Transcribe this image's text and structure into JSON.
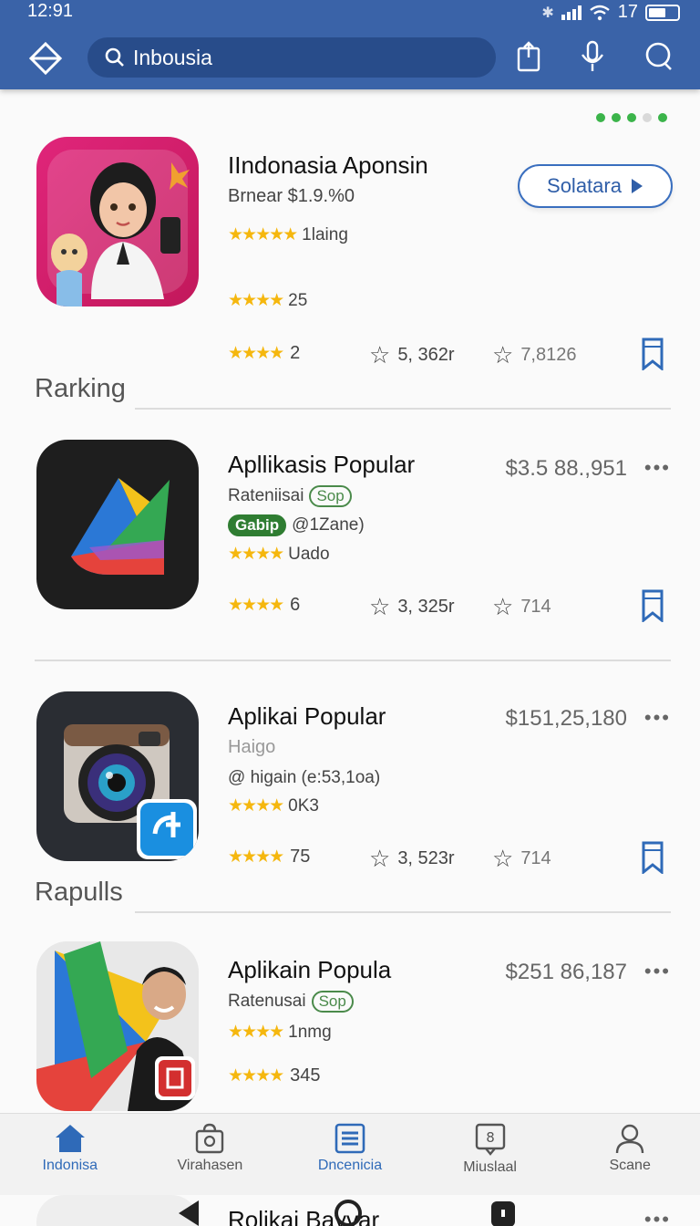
{
  "status_bar": {
    "time": "12:91",
    "signal_text": "17"
  },
  "search": {
    "value": "Inbousia"
  },
  "featured": {
    "title": "IIndonasia Aponsin",
    "subtitle": "Brnear $1.9.%0",
    "rating_label": "1laing",
    "rating2": "25",
    "rating3": "2",
    "downloads": "5, 362r",
    "reviews": "7,8126",
    "button_label": "Solatara"
  },
  "sections": {
    "ranking": "Rarking",
    "popular": "Rapulls"
  },
  "apps": [
    {
      "title": "Apllikasis Popular",
      "subtitle": "Rateniisai",
      "pill": "Sop",
      "tag": "Gabip",
      "tag_text": "@1Zane)",
      "rating_label": "Uado",
      "price": "$3.5 88.,951",
      "rating2": "6",
      "downloads": "3, 325r",
      "reviews": "714"
    },
    {
      "title": "Aplikai Popular",
      "subtitle": "Haigo",
      "tag_text": "@ higain (e:53,1oa)",
      "rating_label": "0K3",
      "price": "$151,25,180",
      "rating2": "75",
      "downloads": "3, 523r",
      "reviews": "714"
    },
    {
      "title": "Aplikain Popula",
      "subtitle": "Ratenusai",
      "pill": "Sop",
      "rating_label": "1nmg",
      "price": "$251 86,187",
      "rating2": "345"
    }
  ],
  "more_label": "•••",
  "nav": [
    {
      "label": "Indonisa",
      "icon": "home-icon"
    },
    {
      "label": "Virahasen",
      "icon": "bag-icon"
    },
    {
      "label": "Dncenicia",
      "icon": "list-icon"
    },
    {
      "label": "Miuslaal",
      "icon": "badge-icon"
    },
    {
      "label": "Scane",
      "icon": "person-icon"
    }
  ],
  "peek": {
    "title": "Rolikai Bayvar"
  },
  "colors": {
    "header": "#3a63a8",
    "accent": "#2f6ab8",
    "star": "#f5b70e",
    "green": "#3bb44a"
  }
}
